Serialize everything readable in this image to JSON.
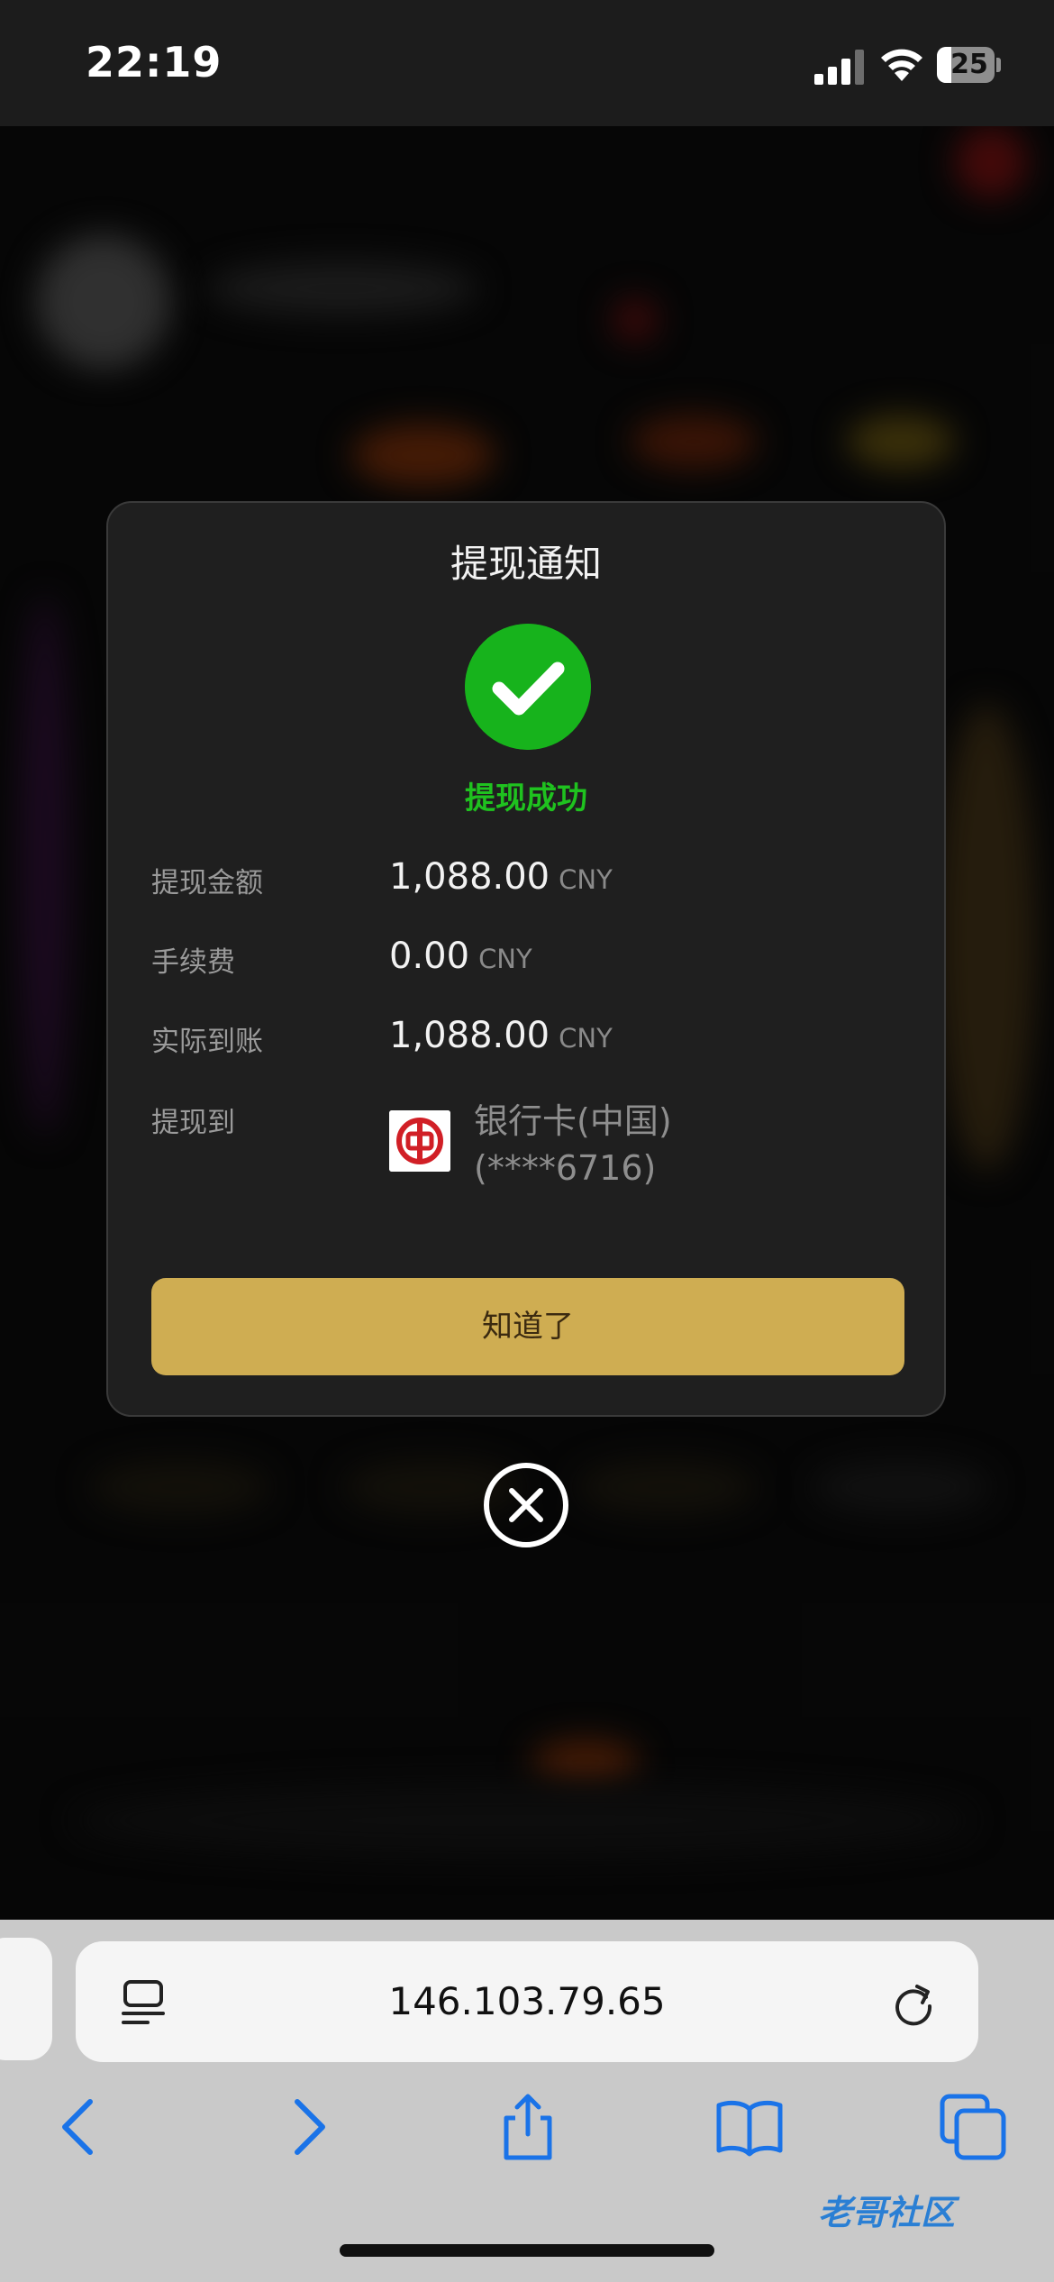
{
  "status_bar": {
    "time": "22:19",
    "battery_level": "25"
  },
  "modal": {
    "title": "提现通知",
    "success_text": "提现成功",
    "rows": [
      {
        "label": "提现金额",
        "value": "1,088.00",
        "unit": "CNY"
      },
      {
        "label": "手续费",
        "value": "0.00",
        "unit": "CNY"
      },
      {
        "label": "实际到账",
        "value": "1,088.00",
        "unit": "CNY"
      }
    ],
    "destination_label": "提现到",
    "bank_name": "银行卡(中国)",
    "card_mask": "(****6716)",
    "ok_button": "知道了"
  },
  "browser": {
    "url": "146.103.79.65"
  },
  "watermark": "老哥社区",
  "colors": {
    "accent_gold": "#cfad52",
    "success_green": "#17b31c",
    "link_blue": "#1a73e8"
  }
}
